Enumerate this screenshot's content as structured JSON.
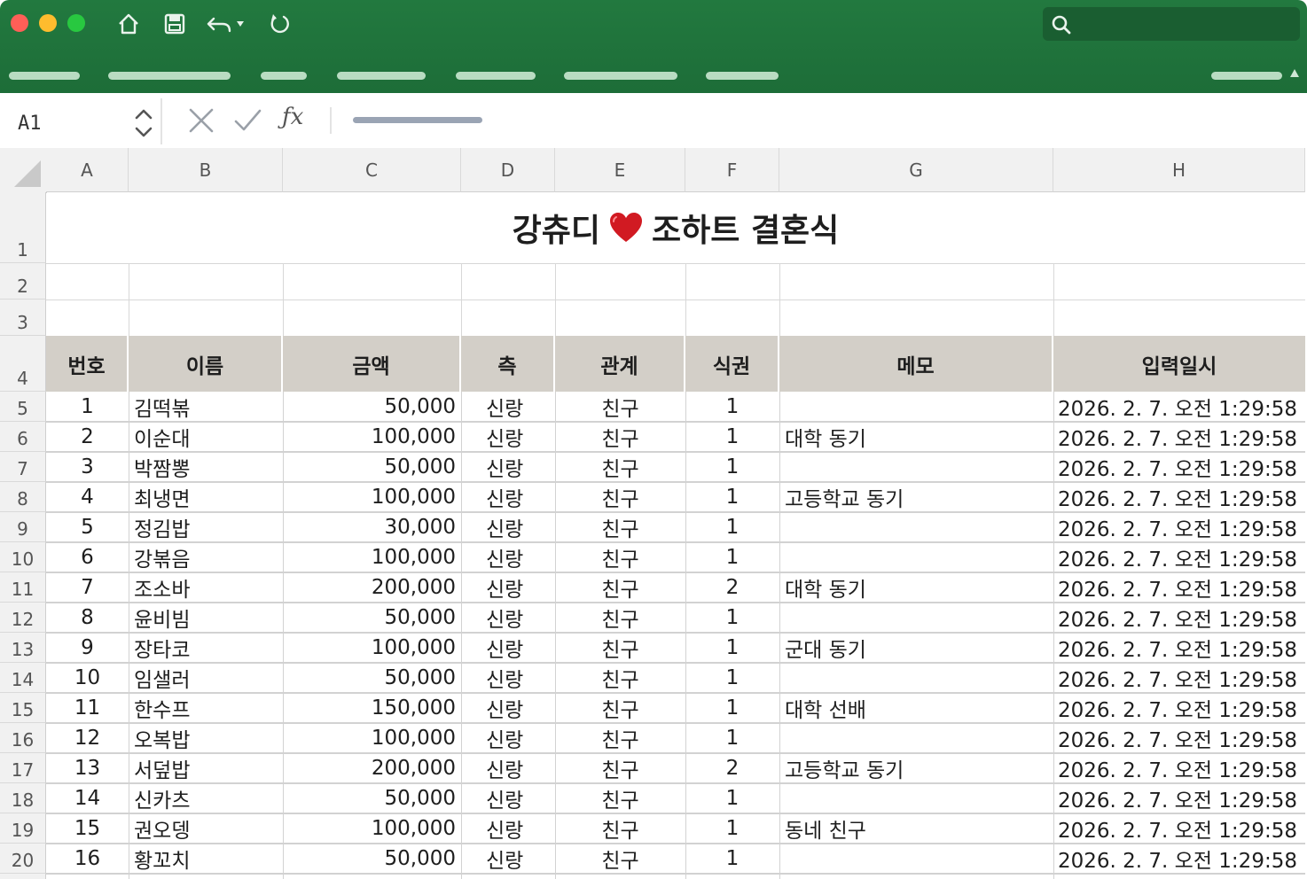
{
  "namebox": {
    "value": "A1"
  },
  "toolbar": {
    "fx_label": "ƒx"
  },
  "columns": [
    "A",
    "B",
    "C",
    "D",
    "E",
    "F",
    "G",
    "H"
  ],
  "rows": [
    "1",
    "2",
    "3",
    "4",
    "5",
    "6",
    "7",
    "8",
    "9",
    "10",
    "11",
    "12",
    "13",
    "14",
    "15",
    "16",
    "17",
    "18",
    "19",
    "20"
  ],
  "sheet": {
    "title_left": "강츄디",
    "title_right": "조하트 결혼식",
    "headers": [
      "번호",
      "이름",
      "금액",
      "측",
      "관계",
      "식권",
      "메모",
      "입력일시"
    ],
    "data": [
      [
        "1",
        "김떡볶",
        "50,000",
        "신랑",
        "친구",
        "1",
        "",
        "2026. 2. 7. 오전 1:29:58"
      ],
      [
        "2",
        "이순대",
        "100,000",
        "신랑",
        "친구",
        "1",
        "대학 동기",
        "2026. 2. 7. 오전 1:29:58"
      ],
      [
        "3",
        "박짬뽕",
        "50,000",
        "신랑",
        "친구",
        "1",
        "",
        "2026. 2. 7. 오전 1:29:58"
      ],
      [
        "4",
        "최냉면",
        "100,000",
        "신랑",
        "친구",
        "1",
        "고등학교 동기",
        "2026. 2. 7. 오전 1:29:58"
      ],
      [
        "5",
        "정김밥",
        "30,000",
        "신랑",
        "친구",
        "1",
        "",
        "2026. 2. 7. 오전 1:29:58"
      ],
      [
        "6",
        "강볶음",
        "100,000",
        "신랑",
        "친구",
        "1",
        "",
        "2026. 2. 7. 오전 1:29:58"
      ],
      [
        "7",
        "조소바",
        "200,000",
        "신랑",
        "친구",
        "2",
        "대학 동기",
        "2026. 2. 7. 오전 1:29:58"
      ],
      [
        "8",
        "윤비빔",
        "50,000",
        "신랑",
        "친구",
        "1",
        "",
        "2026. 2. 7. 오전 1:29:58"
      ],
      [
        "9",
        "장타코",
        "100,000",
        "신랑",
        "친구",
        "1",
        "군대 동기",
        "2026. 2. 7. 오전 1:29:58"
      ],
      [
        "10",
        "임샐러",
        "50,000",
        "신랑",
        "친구",
        "1",
        "",
        "2026. 2. 7. 오전 1:29:58"
      ],
      [
        "11",
        "한수프",
        "150,000",
        "신랑",
        "친구",
        "1",
        "대학 선배",
        "2026. 2. 7. 오전 1:29:58"
      ],
      [
        "12",
        "오복밥",
        "100,000",
        "신랑",
        "친구",
        "1",
        "",
        "2026. 2. 7. 오전 1:29:58"
      ],
      [
        "13",
        "서덮밥",
        "200,000",
        "신랑",
        "친구",
        "2",
        "고등학교 동기",
        "2026. 2. 7. 오전 1:29:58"
      ],
      [
        "14",
        "신카츠",
        "50,000",
        "신랑",
        "친구",
        "1",
        "",
        "2026. 2. 7. 오전 1:29:58"
      ],
      [
        "15",
        "권오뎅",
        "100,000",
        "신랑",
        "친구",
        "1",
        "동네 친구",
        "2026. 2. 7. 오전 1:29:58"
      ],
      [
        "16",
        "황꼬치",
        "50,000",
        "신랑",
        "친구",
        "1",
        "",
        "2026. 2. 7. 오전 1:29:58"
      ]
    ]
  },
  "colors": {
    "ribbon": "#1f703a",
    "header_band": "#d3cfc8",
    "heart": "#d11a22"
  }
}
